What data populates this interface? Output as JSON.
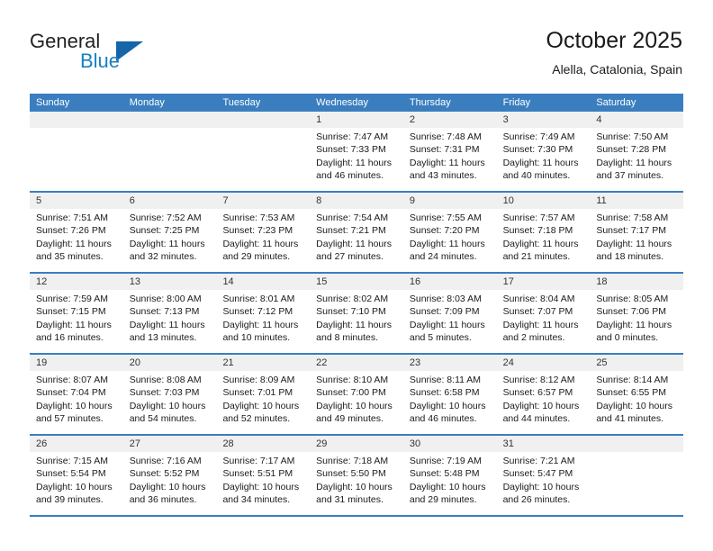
{
  "brand": {
    "name_part1": "General",
    "name_part2": "Blue",
    "accent_color": "#1a7fc1",
    "triangle_color": "#1565a8"
  },
  "header": {
    "title": "October 2025",
    "subtitle": "Alella, Catalonia, Spain"
  },
  "theme": {
    "header_blue": "#3a7ebf",
    "date_band_gray": "#f0f0f0"
  },
  "weekday_headers": [
    "Sunday",
    "Monday",
    "Tuesday",
    "Wednesday",
    "Thursday",
    "Friday",
    "Saturday"
  ],
  "weeks": [
    [
      {
        "day": "",
        "lines": []
      },
      {
        "day": "",
        "lines": []
      },
      {
        "day": "",
        "lines": []
      },
      {
        "day": "1",
        "lines": [
          "Sunrise: 7:47 AM",
          "Sunset: 7:33 PM",
          "Daylight: 11 hours",
          "and 46 minutes."
        ]
      },
      {
        "day": "2",
        "lines": [
          "Sunrise: 7:48 AM",
          "Sunset: 7:31 PM",
          "Daylight: 11 hours",
          "and 43 minutes."
        ]
      },
      {
        "day": "3",
        "lines": [
          "Sunrise: 7:49 AM",
          "Sunset: 7:30 PM",
          "Daylight: 11 hours",
          "and 40 minutes."
        ]
      },
      {
        "day": "4",
        "lines": [
          "Sunrise: 7:50 AM",
          "Sunset: 7:28 PM",
          "Daylight: 11 hours",
          "and 37 minutes."
        ]
      }
    ],
    [
      {
        "day": "5",
        "lines": [
          "Sunrise: 7:51 AM",
          "Sunset: 7:26 PM",
          "Daylight: 11 hours",
          "and 35 minutes."
        ]
      },
      {
        "day": "6",
        "lines": [
          "Sunrise: 7:52 AM",
          "Sunset: 7:25 PM",
          "Daylight: 11 hours",
          "and 32 minutes."
        ]
      },
      {
        "day": "7",
        "lines": [
          "Sunrise: 7:53 AM",
          "Sunset: 7:23 PM",
          "Daylight: 11 hours",
          "and 29 minutes."
        ]
      },
      {
        "day": "8",
        "lines": [
          "Sunrise: 7:54 AM",
          "Sunset: 7:21 PM",
          "Daylight: 11 hours",
          "and 27 minutes."
        ]
      },
      {
        "day": "9",
        "lines": [
          "Sunrise: 7:55 AM",
          "Sunset: 7:20 PM",
          "Daylight: 11 hours",
          "and 24 minutes."
        ]
      },
      {
        "day": "10",
        "lines": [
          "Sunrise: 7:57 AM",
          "Sunset: 7:18 PM",
          "Daylight: 11 hours",
          "and 21 minutes."
        ]
      },
      {
        "day": "11",
        "lines": [
          "Sunrise: 7:58 AM",
          "Sunset: 7:17 PM",
          "Daylight: 11 hours",
          "and 18 minutes."
        ]
      }
    ],
    [
      {
        "day": "12",
        "lines": [
          "Sunrise: 7:59 AM",
          "Sunset: 7:15 PM",
          "Daylight: 11 hours",
          "and 16 minutes."
        ]
      },
      {
        "day": "13",
        "lines": [
          "Sunrise: 8:00 AM",
          "Sunset: 7:13 PM",
          "Daylight: 11 hours",
          "and 13 minutes."
        ]
      },
      {
        "day": "14",
        "lines": [
          "Sunrise: 8:01 AM",
          "Sunset: 7:12 PM",
          "Daylight: 11 hours",
          "and 10 minutes."
        ]
      },
      {
        "day": "15",
        "lines": [
          "Sunrise: 8:02 AM",
          "Sunset: 7:10 PM",
          "Daylight: 11 hours",
          "and 8 minutes."
        ]
      },
      {
        "day": "16",
        "lines": [
          "Sunrise: 8:03 AM",
          "Sunset: 7:09 PM",
          "Daylight: 11 hours",
          "and 5 minutes."
        ]
      },
      {
        "day": "17",
        "lines": [
          "Sunrise: 8:04 AM",
          "Sunset: 7:07 PM",
          "Daylight: 11 hours",
          "and 2 minutes."
        ]
      },
      {
        "day": "18",
        "lines": [
          "Sunrise: 8:05 AM",
          "Sunset: 7:06 PM",
          "Daylight: 11 hours",
          "and 0 minutes."
        ]
      }
    ],
    [
      {
        "day": "19",
        "lines": [
          "Sunrise: 8:07 AM",
          "Sunset: 7:04 PM",
          "Daylight: 10 hours",
          "and 57 minutes."
        ]
      },
      {
        "day": "20",
        "lines": [
          "Sunrise: 8:08 AM",
          "Sunset: 7:03 PM",
          "Daylight: 10 hours",
          "and 54 minutes."
        ]
      },
      {
        "day": "21",
        "lines": [
          "Sunrise: 8:09 AM",
          "Sunset: 7:01 PM",
          "Daylight: 10 hours",
          "and 52 minutes."
        ]
      },
      {
        "day": "22",
        "lines": [
          "Sunrise: 8:10 AM",
          "Sunset: 7:00 PM",
          "Daylight: 10 hours",
          "and 49 minutes."
        ]
      },
      {
        "day": "23",
        "lines": [
          "Sunrise: 8:11 AM",
          "Sunset: 6:58 PM",
          "Daylight: 10 hours",
          "and 46 minutes."
        ]
      },
      {
        "day": "24",
        "lines": [
          "Sunrise: 8:12 AM",
          "Sunset: 6:57 PM",
          "Daylight: 10 hours",
          "and 44 minutes."
        ]
      },
      {
        "day": "25",
        "lines": [
          "Sunrise: 8:14 AM",
          "Sunset: 6:55 PM",
          "Daylight: 10 hours",
          "and 41 minutes."
        ]
      }
    ],
    [
      {
        "day": "26",
        "lines": [
          "Sunrise: 7:15 AM",
          "Sunset: 5:54 PM",
          "Daylight: 10 hours",
          "and 39 minutes."
        ]
      },
      {
        "day": "27",
        "lines": [
          "Sunrise: 7:16 AM",
          "Sunset: 5:52 PM",
          "Daylight: 10 hours",
          "and 36 minutes."
        ]
      },
      {
        "day": "28",
        "lines": [
          "Sunrise: 7:17 AM",
          "Sunset: 5:51 PM",
          "Daylight: 10 hours",
          "and 34 minutes."
        ]
      },
      {
        "day": "29",
        "lines": [
          "Sunrise: 7:18 AM",
          "Sunset: 5:50 PM",
          "Daylight: 10 hours",
          "and 31 minutes."
        ]
      },
      {
        "day": "30",
        "lines": [
          "Sunrise: 7:19 AM",
          "Sunset: 5:48 PM",
          "Daylight: 10 hours",
          "and 29 minutes."
        ]
      },
      {
        "day": "31",
        "lines": [
          "Sunrise: 7:21 AM",
          "Sunset: 5:47 PM",
          "Daylight: 10 hours",
          "and 26 minutes."
        ]
      },
      {
        "day": "",
        "lines": []
      }
    ]
  ]
}
